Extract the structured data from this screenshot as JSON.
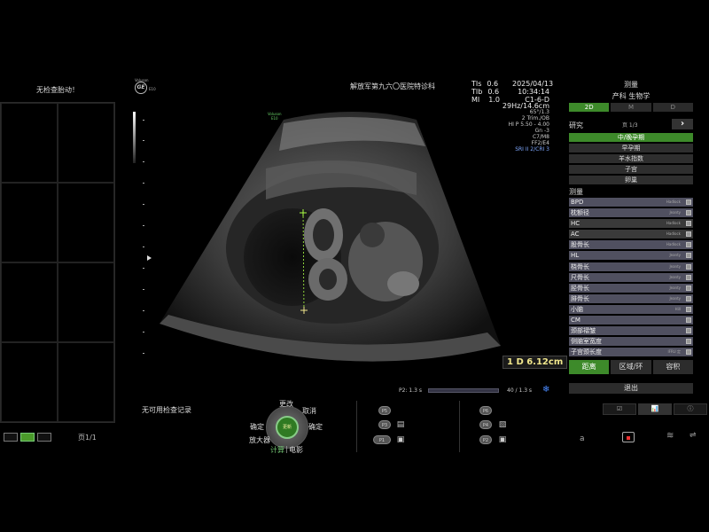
{
  "left": {
    "title": "无检查胎动！",
    "page": "页1/1"
  },
  "header": {
    "logo_top": "Voluson",
    "logo_mark": "GE",
    "logo_model": "E10",
    "hospital": "解放军第九六〇医院特诊科",
    "tis_label": "TIs",
    "tis_value": "0.6",
    "tib_label": "TIb",
    "tib_value": "0.6",
    "mi_label": "MI",
    "mi_value": "1.0",
    "date": "2025/04/13",
    "time": "10:34:14",
    "probe": "C1-6-D"
  },
  "params": {
    "line1": "29Hz/14.6cm",
    "line2": "65°/1.3",
    "line3": "2 Trim./OB",
    "line4": "HI P 5.50 - 4.00",
    "line5": "Gn -3",
    "line6": "C7/M8",
    "line7": "FF2/E4",
    "line8": "SRI II 2/CRI 3"
  },
  "image": {
    "probe_label_1": "Voluson",
    "probe_label_2": "E10"
  },
  "measurement_result": "1 D 6.12cm",
  "cine": {
    "left": "P2: 1.3 s",
    "right": "40 / 1.3 s"
  },
  "right_panel": {
    "title": "测量",
    "subtitle": "产科 生物学",
    "modes": [
      "2D",
      "M",
      "D"
    ],
    "study_label": "研究",
    "study_page": "页 1/3",
    "studies": [
      "中/晚孕期",
      "早孕期",
      "羊水指数",
      "子宫",
      "卵巢"
    ],
    "meas_label": "测量",
    "measurements": [
      {
        "name": "BPD",
        "method": "Hadlock"
      },
      {
        "name": "枕额径",
        "method": "Jeanty"
      },
      {
        "name": "HC",
        "method": "Hadlock"
      },
      {
        "name": "AC",
        "method": "Hadlock"
      },
      {
        "name": "股骨长",
        "method": "Hadlock"
      },
      {
        "name": "HL",
        "method": "Jeanty"
      },
      {
        "name": "桡骨长",
        "method": "Jeanty"
      },
      {
        "name": "尺骨长",
        "method": "Jeanty"
      },
      {
        "name": "胫骨长",
        "method": "Jeanty"
      },
      {
        "name": "腓骨长",
        "method": "Jeanty"
      },
      {
        "name": "小脑",
        "method": "Hill"
      },
      {
        "name": "CM",
        "method": ""
      },
      {
        "name": "颈部褶皱",
        "method": ""
      },
      {
        "name": "侧脑室宽度",
        "method": ""
      },
      {
        "name": "子宫颈长度",
        "method": "IFRU 定"
      }
    ],
    "tools": [
      "距离",
      "区域/环",
      "容积"
    ],
    "exit": "退出",
    "bottom_tabs": [
      "☑",
      "📊",
      "ⓘ"
    ]
  },
  "controls": {
    "no_records": "无可用检查记录",
    "dial_center": "更新",
    "change": "更改",
    "confirm": "确定",
    "cancel": "取消",
    "confirm2": "确定",
    "zoom": "放大器",
    "calc": "计算",
    "sep": "|",
    "cine": "电影",
    "p_buttons_left": [
      "P5",
      "P3",
      "P1"
    ],
    "p_buttons_right": [
      "P6",
      "P4",
      "P2"
    ]
  },
  "status": {
    "a_label": "a"
  },
  "colors": {
    "accent": "#3d8a2a",
    "measure_text": "#f0e68c",
    "caliper": "#aaff44"
  }
}
